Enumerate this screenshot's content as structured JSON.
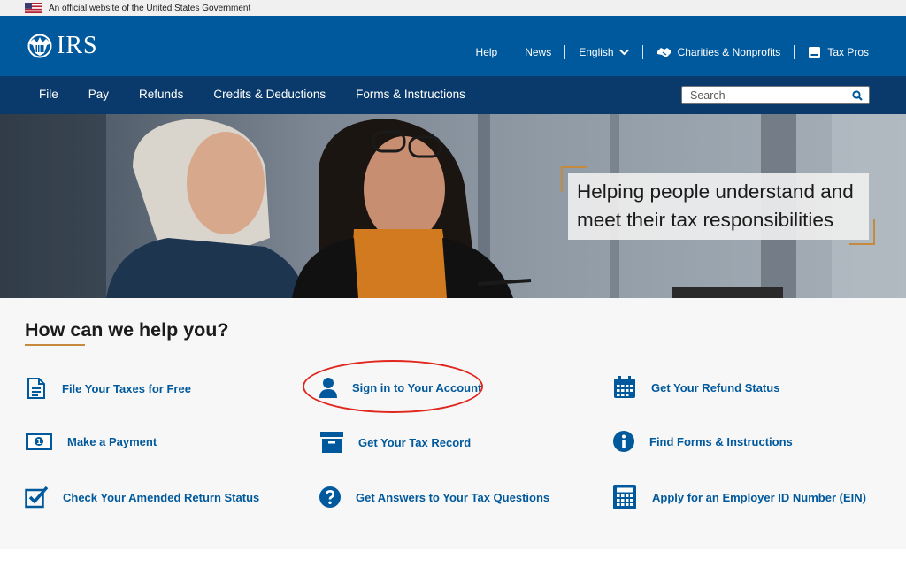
{
  "gov_banner": {
    "text": "An official website of the United States Government"
  },
  "header": {
    "logo_text": "IRS",
    "utility_nav": [
      {
        "label": "Help"
      },
      {
        "label": "News"
      },
      {
        "label": "English",
        "icon": "chevron-down-icon"
      },
      {
        "label": "Charities & Nonprofits",
        "icon": "handshake-icon"
      },
      {
        "label": "Tax Pros",
        "icon": "briefcase-icon"
      }
    ]
  },
  "main_nav": {
    "items": [
      {
        "label": "File"
      },
      {
        "label": "Pay"
      },
      {
        "label": "Refunds"
      },
      {
        "label": "Credits & Deductions"
      },
      {
        "label": "Forms & Instructions"
      }
    ],
    "search_placeholder": "Search"
  },
  "hero": {
    "text": "Helping people understand and meet their tax responsibilities"
  },
  "help_section": {
    "title": "How can we help you?",
    "links": [
      {
        "label": "File Your Taxes for Free",
        "icon": "document-icon"
      },
      {
        "label": "Sign in to Your Account",
        "icon": "user-icon"
      },
      {
        "label": "Get Your Refund Status",
        "icon": "calendar-icon"
      },
      {
        "label": "Make a Payment",
        "icon": "money-icon"
      },
      {
        "label": "Get Your Tax Record",
        "icon": "archive-box-icon"
      },
      {
        "label": "Find Forms & Instructions",
        "icon": "info-icon"
      },
      {
        "label": "Check Your Amended Return Status",
        "icon": "checkbox-icon"
      },
      {
        "label": "Get Answers to Your Tax Questions",
        "icon": "question-icon"
      },
      {
        "label": "Apply for an Employer ID Number (EIN)",
        "icon": "calculator-icon"
      }
    ]
  },
  "colors": {
    "header_blue": "#00599c",
    "nav_navy": "#0a3a6b",
    "link_blue": "#00599c",
    "accent_gold": "#c58a3d",
    "annotation_red": "#e0271e"
  }
}
